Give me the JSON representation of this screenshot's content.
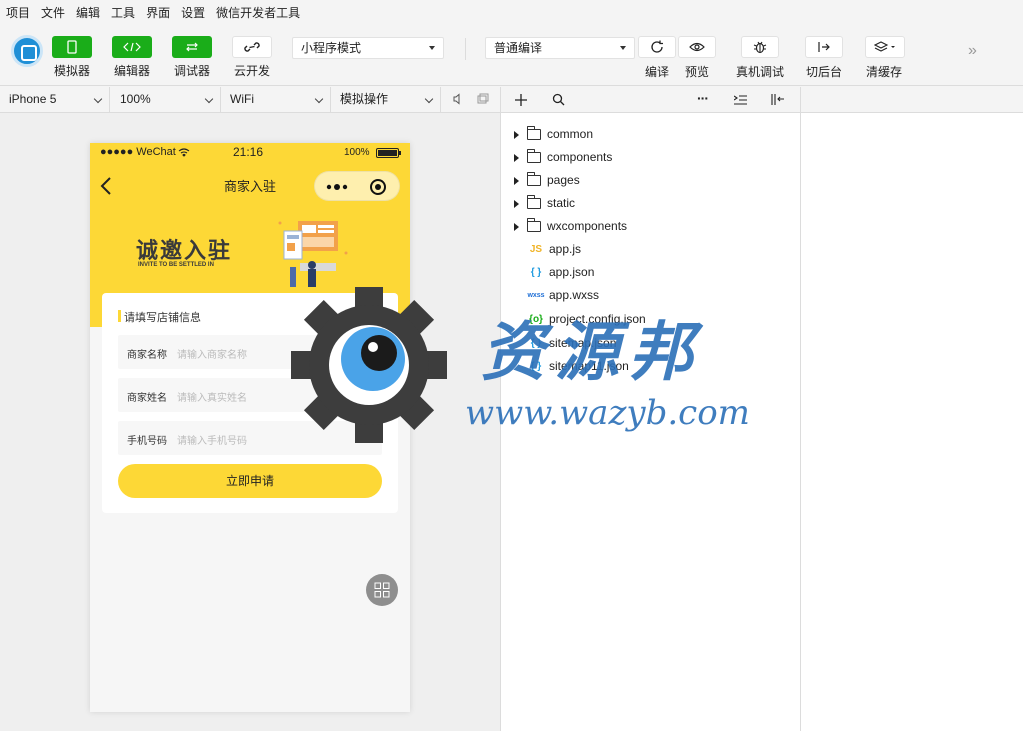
{
  "menu": [
    "项目",
    "文件",
    "编辑",
    "工具",
    "界面",
    "设置",
    "微信开发者工具"
  ],
  "toolbar": {
    "simulator": "模拟器",
    "editor": "编辑器",
    "debugger": "调试器",
    "cloud": "云开发",
    "mode": "小程序模式",
    "compile_mode": "普通编译",
    "compile": "编译",
    "preview": "预览",
    "real_debug": "真机调试",
    "background": "切后台",
    "clear_cache": "清缓存",
    "colors": {
      "green": "#1aad19",
      "brand": "#1f8fd6"
    }
  },
  "simbar": {
    "device": "iPhone 5",
    "zoom": "100%",
    "network": "WiFi",
    "operation": "模拟操作"
  },
  "phone": {
    "status_left": "●●●●● WeChat",
    "time": "21:16",
    "battery": "100%",
    "title": "商家入驻",
    "banner_title": "诚邀入驻",
    "banner_sub": "INVITE TO BE SETTLED IN",
    "section_title": "请填写店铺信息",
    "fields": [
      {
        "label": "商家名称",
        "placeholder": "请输入商家名称"
      },
      {
        "label": "商家姓名",
        "placeholder": "请输入真实姓名"
      },
      {
        "label": "手机号码",
        "placeholder": "请输入手机号码"
      }
    ],
    "apply_button": "立即申请",
    "colors": {
      "theme": "#fdd836"
    }
  },
  "explorer": {
    "folders": [
      "common",
      "components",
      "pages",
      "static",
      "wxcomponents"
    ],
    "files": [
      {
        "name": "app.js",
        "icon": "JS",
        "color": "#f0b429"
      },
      {
        "name": "app.json",
        "icon": "{ }",
        "color": "#1f9be0"
      },
      {
        "name": "app.wxss",
        "icon": "wxss",
        "color": "#1f6fd6"
      },
      {
        "name": "project.config.json",
        "icon": "{o}",
        "color": "#1aad19"
      },
      {
        "name": "sitemap.json",
        "icon": "{ }",
        "color": "#1f9be0"
      },
      {
        "name": "sitemap11.json",
        "icon": "{ }",
        "color": "#1f9be0"
      }
    ]
  },
  "watermark": {
    "title": "资源邦",
    "url": "www.wazyb.com"
  }
}
